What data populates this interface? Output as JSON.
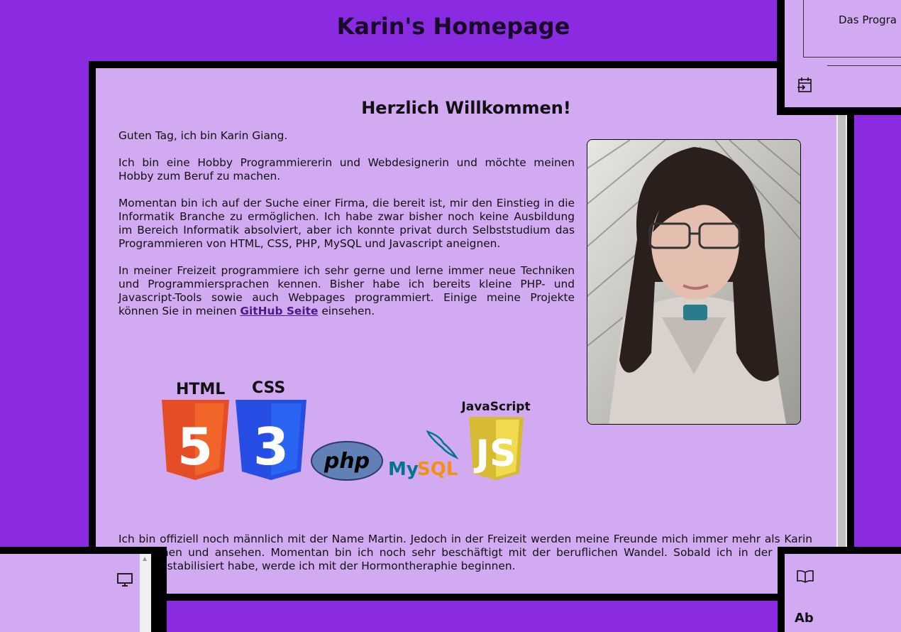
{
  "header": {
    "title": "Karin's Homepage"
  },
  "main": {
    "heading": "Herzlich Willkommen!",
    "paragraphs": [
      "Guten Tag, ich bin Karin Giang.",
      "Ich bin eine Hobby Programmiererin und Webdesignerin und möchte meinen Hobby zum Beruf zu machen.",
      "Momentan bin ich auf der Suche einer Firma, die bereit ist, mir den Einstieg in die Informatik Branche zu ermöglichen. Ich habe zwar bisher noch keine Ausbildung im Bereich Informatik absolviert, aber ich konnte privat durch Selbststudium das Programmieren von HTML, CSS, PHP, MySQL und Javascript aneignen."
    ],
    "freizeit_before": "In meiner Freizeit programmiere ich sehr gerne und lerne immer neue Techniken und Programmiersprachen kennen. Bisher habe ich bereits kleine PHP- und Javascript-Tools sowie auch Webpages programmiert. Einige meine Projekte können Sie in meinen ",
    "github_link": "GitHub Seite",
    "freizeit_after": " einsehen.",
    "logos": {
      "html_label": "HTML",
      "html_digit": "5",
      "css_label": "CSS",
      "css_digit": "3",
      "php_label": "php",
      "mysql_my": "My",
      "mysql_sql": "SQL",
      "js_label": "JavaScript",
      "js_letters": "JS"
    },
    "bottom_paragraph": "Ich bin offiziell noch männlich mit der Name Martin. Jedoch in der Freizeit werden meine Freunde mich immer mehr als Karin ansprechen und ansehen. Momentan bin ich noch sehr beschäftigt mit der beruflichen Wandel. Sobald ich in der neuen Branche stabilisiert habe, werde ich mit der Hormontheraphie beginnen."
  },
  "top_right": {
    "text": "Das Progra"
  },
  "bottom_right": {
    "text": "Ab"
  },
  "icons": {
    "top_right": "calendar-arrow-icon",
    "bottom_left": "monitor-icon",
    "bottom_right": "book-icon"
  },
  "colors": {
    "page_background": "#8a2be2",
    "panel_background": "#d2aaf2",
    "border": "#000000",
    "link": "#4b1a85"
  }
}
